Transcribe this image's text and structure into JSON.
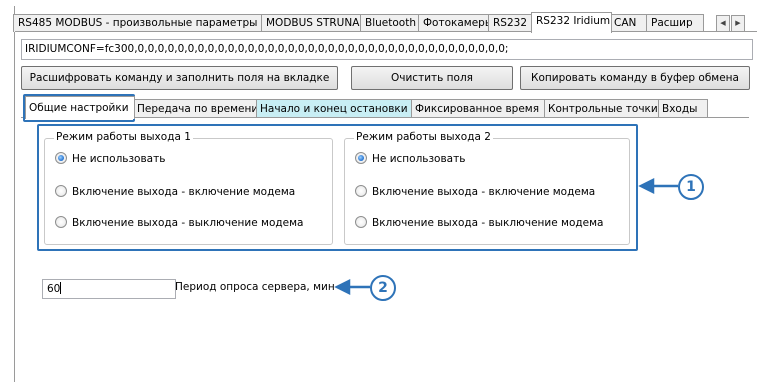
{
  "outer_tabs": [
    {
      "label": "RS485 MODBUS - произвольные параметры",
      "active": false
    },
    {
      "label": "MODBUS STRUNA+",
      "active": false
    },
    {
      "label": "Bluetooth",
      "active": false
    },
    {
      "label": "Фотокамеры",
      "active": false
    },
    {
      "label": "RS232",
      "active": false
    },
    {
      "label": "RS232 Iridium",
      "active": true
    },
    {
      "label": "CAN",
      "active": false
    },
    {
      "label": "Расшир",
      "active": false
    }
  ],
  "command": {
    "value": "IRIDIUMCONF=fc300,0,0,0,0,0,0,0,0,0,0,0,0,0,0,0,0,0,0,0,0,0,0,0,0,0,0,0,0,0,0,0,0,0,0,0,0,0;"
  },
  "buttons": {
    "decode": "Расшифровать команду и заполнить поля на вкладке",
    "clear": "Очистить поля",
    "copy": "Копировать команду в буфер обмена"
  },
  "inner_tabs": [
    {
      "label": "Общие настройки",
      "active": true
    },
    {
      "label": "Передача по времени",
      "active": false
    },
    {
      "label": "Начало и конец остановки",
      "active": false
    },
    {
      "label": "Фиксированное время",
      "active": false
    },
    {
      "label": "Контрольные точки",
      "active": false
    },
    {
      "label": "Входы",
      "active": false
    }
  ],
  "output1": {
    "title": "Режим работы выхода 1",
    "options": [
      "Не использовать",
      "Включение выхода - включение модема",
      "Включение выхода - выключение модема"
    ],
    "selected": 0
  },
  "output2": {
    "title": "Режим работы выхода 2",
    "options": [
      "Не использовать",
      "Включение выхода - включение модема",
      "Включение выхода - выключение модема"
    ],
    "selected": 0
  },
  "period": {
    "value": "60",
    "label": "Период опроса сервера, мин"
  },
  "callouts": [
    "1",
    "2"
  ],
  "colors": {
    "callout": "#2e73b8",
    "tab_highlight": "#c8eef4"
  }
}
